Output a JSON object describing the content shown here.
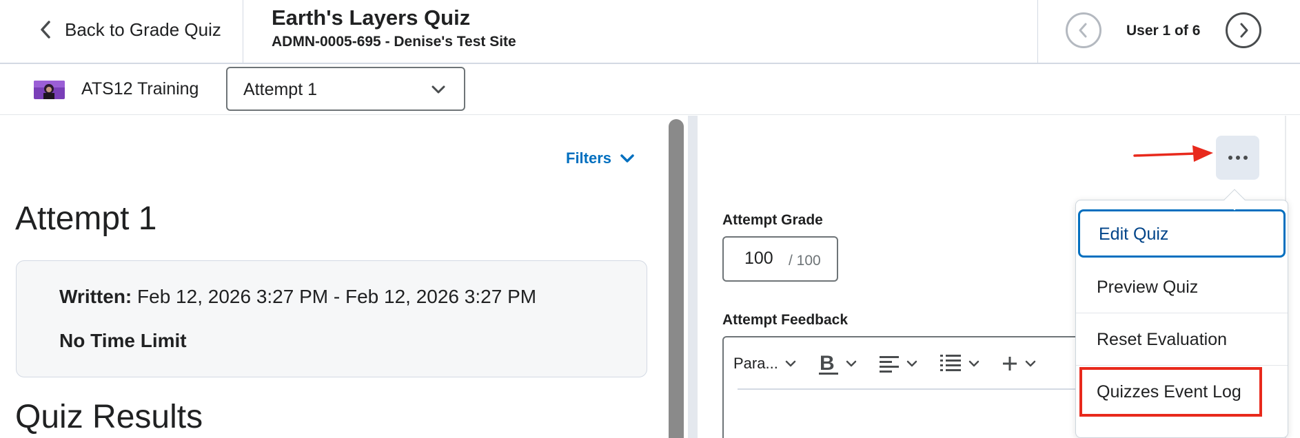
{
  "header": {
    "back_label": "Back to Grade Quiz",
    "quiz_title": "Earth's Layers Quiz",
    "course_subtitle": "ADMN-0005-695 - Denise's Test Site",
    "user_position": "User 1 of 6"
  },
  "student_bar": {
    "student_name": "ATS12 Training",
    "attempt_selected": "Attempt 1"
  },
  "left_pane": {
    "filters_label": "Filters",
    "attempt_heading": "Attempt 1",
    "written_label": "Written:",
    "written_value": "Feb 12, 2026 3:27 PM - Feb 12, 2026 3:27 PM",
    "time_limit": "No Time Limit",
    "results_heading": "Quiz Results"
  },
  "right_pane": {
    "attempt_grade_label": "Attempt Grade",
    "grade_value": "100",
    "grade_out_of": "/ 100",
    "attempt_feedback_label": "Attempt Feedback",
    "editor": {
      "paragraph_style": "Para..."
    }
  },
  "more_menu": {
    "items": [
      {
        "label": "Edit Quiz"
      },
      {
        "label": "Preview Quiz"
      },
      {
        "label": "Reset Evaluation"
      },
      {
        "label": "Quizzes Event Log"
      }
    ]
  },
  "colors": {
    "link_blue": "#006fbf",
    "focus_blue": "#006fbf",
    "annotation_red": "#e8291c",
    "more_button_bg": "#e3e9f1"
  }
}
